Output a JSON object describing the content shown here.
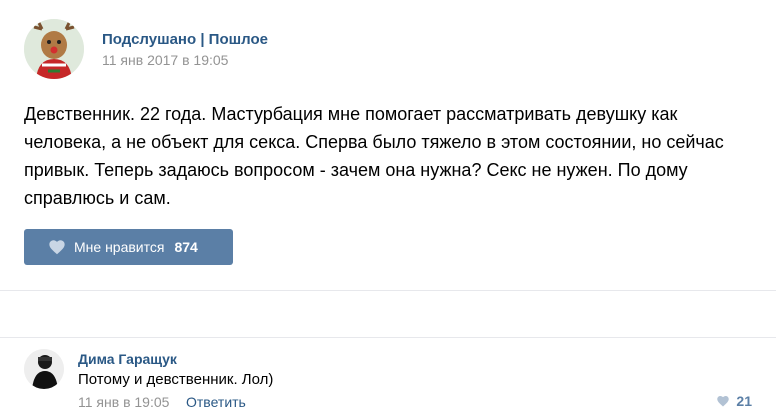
{
  "post": {
    "author": "Подслушано | Пошлое",
    "date": "11 янв 2017 в 19:05",
    "text": "Девственник. 22 года. Мастурбация мне помогает рассматривать девушку как человека, а не объект для секса. Сперва было тяжело в этом состоянии, но сейчас привык. Теперь задаюсь вопросом - зачем она нужна? Секс не нужен. По дому справлюсь и сам.",
    "like_label": "Мне нравится",
    "like_count": "874",
    "like_icon": "heart-icon"
  },
  "comment": {
    "author": "Дима Гаращук",
    "text": "Потому и девственник. Лол)",
    "date": "11 янв в 19:05",
    "reply_label": "Ответить",
    "like_count": "21",
    "like_icon": "heart-icon"
  },
  "colors": {
    "link": "#2a5885",
    "like_button_bg": "#5b7fa6",
    "meta_text": "#939393",
    "divider": "#e7e8ec"
  }
}
